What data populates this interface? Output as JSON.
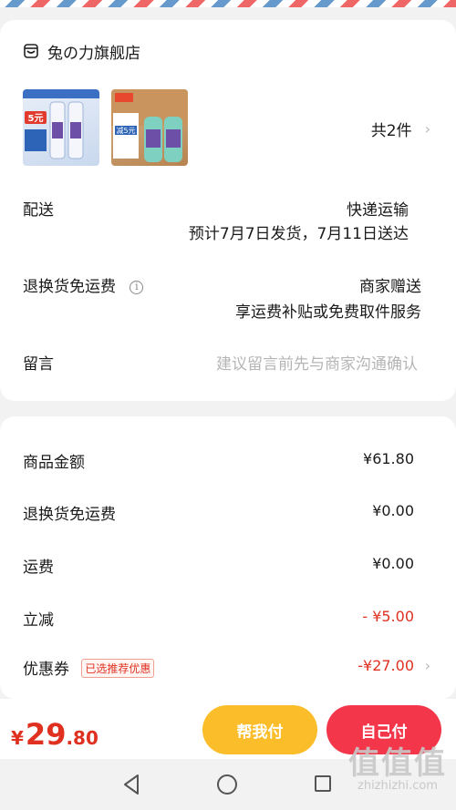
{
  "order": {
    "shop_name": "兔の力旗舰店",
    "item_count": "共2件",
    "thumb1_badge": "5元",
    "thumb2_badge": "减5元",
    "delivery": {
      "label": "配送",
      "method": "快递运输",
      "estimate": "预计7月7日发货，7月11日送达"
    },
    "return_shipping": {
      "label": "退换货免运费",
      "value": "商家赠送",
      "sub": "享运费补贴或免费取件服务"
    },
    "message": {
      "label": "留言",
      "placeholder": "建议留言前先与商家沟通确认"
    }
  },
  "prices": {
    "items_amount_label": "商品金额",
    "items_amount": "¥61.80",
    "return_fee_label": "退换货免运费",
    "return_fee": "¥0.00",
    "shipping_label": "运费",
    "shipping": "¥0.00",
    "discount_label": "立减",
    "discount": "- ¥5.00",
    "coupon_label": "优惠券",
    "coupon_tag": "已选推荐优惠",
    "coupon": "-¥27.00"
  },
  "footer": {
    "currency": "¥",
    "total_int": "29",
    "total_dec": ".80",
    "help_pay_label": "帮我付",
    "self_pay_label": "自己付"
  },
  "watermark": {
    "big": "值值值",
    "small": "zhizhizhi.com"
  },
  "colors": {
    "accent_red": "#e03020",
    "help_button": "#fbbd2a",
    "self_button": "#f4364a"
  }
}
